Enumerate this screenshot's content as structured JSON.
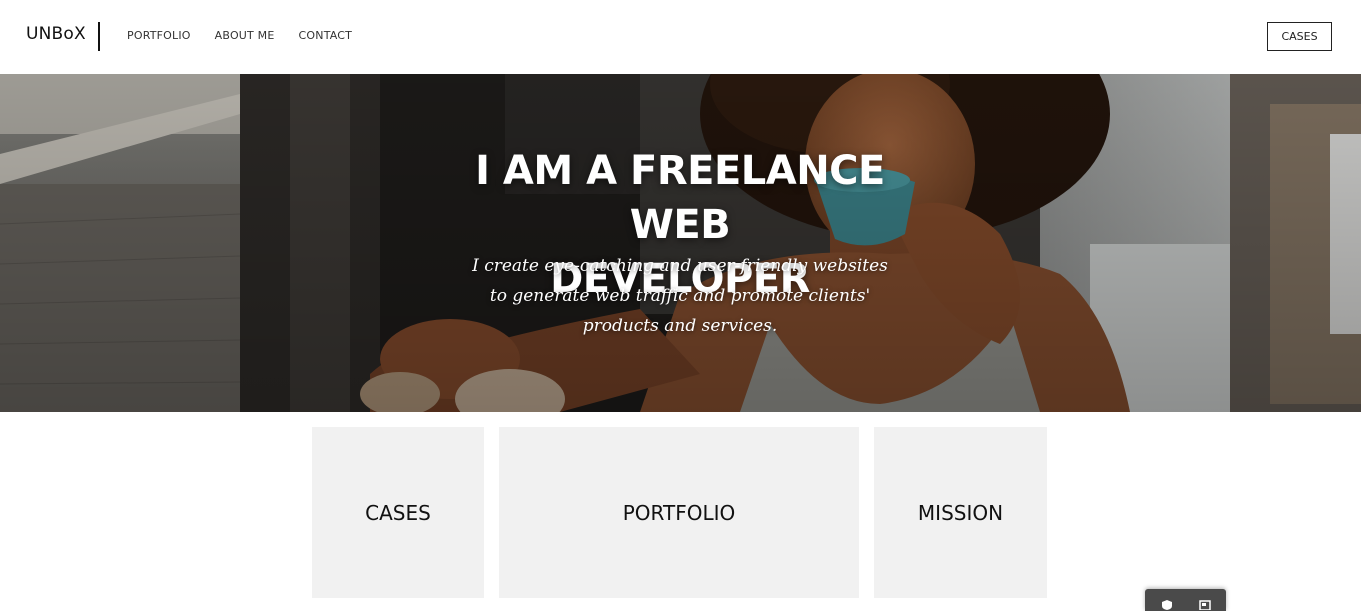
{
  "header": {
    "logo": "UNBoX",
    "nav": [
      "PORTFOLIO",
      "ABOUT ME",
      "CONTACT"
    ],
    "cta_label": "CASES"
  },
  "hero": {
    "title_line1": "I AM A FREELANCE WEB",
    "title_line2": "DEVELOPER",
    "subtitle": "I create eye-catching and user-friendly websites to generate web traffic and promote clients' products and services."
  },
  "tiles": [
    {
      "label": "CASES"
    },
    {
      "label": "PORTFOLIO"
    },
    {
      "label": "MISSION"
    }
  ],
  "colors": {
    "tile_bg": "#f1f1f1",
    "text_dark": "#111111",
    "hero_overlay": "#3b3835",
    "mug": "#3f8a92",
    "widget_bg": "#4a4a4a"
  },
  "widget": {
    "icons": [
      "shield-icon",
      "panel-icon"
    ]
  }
}
